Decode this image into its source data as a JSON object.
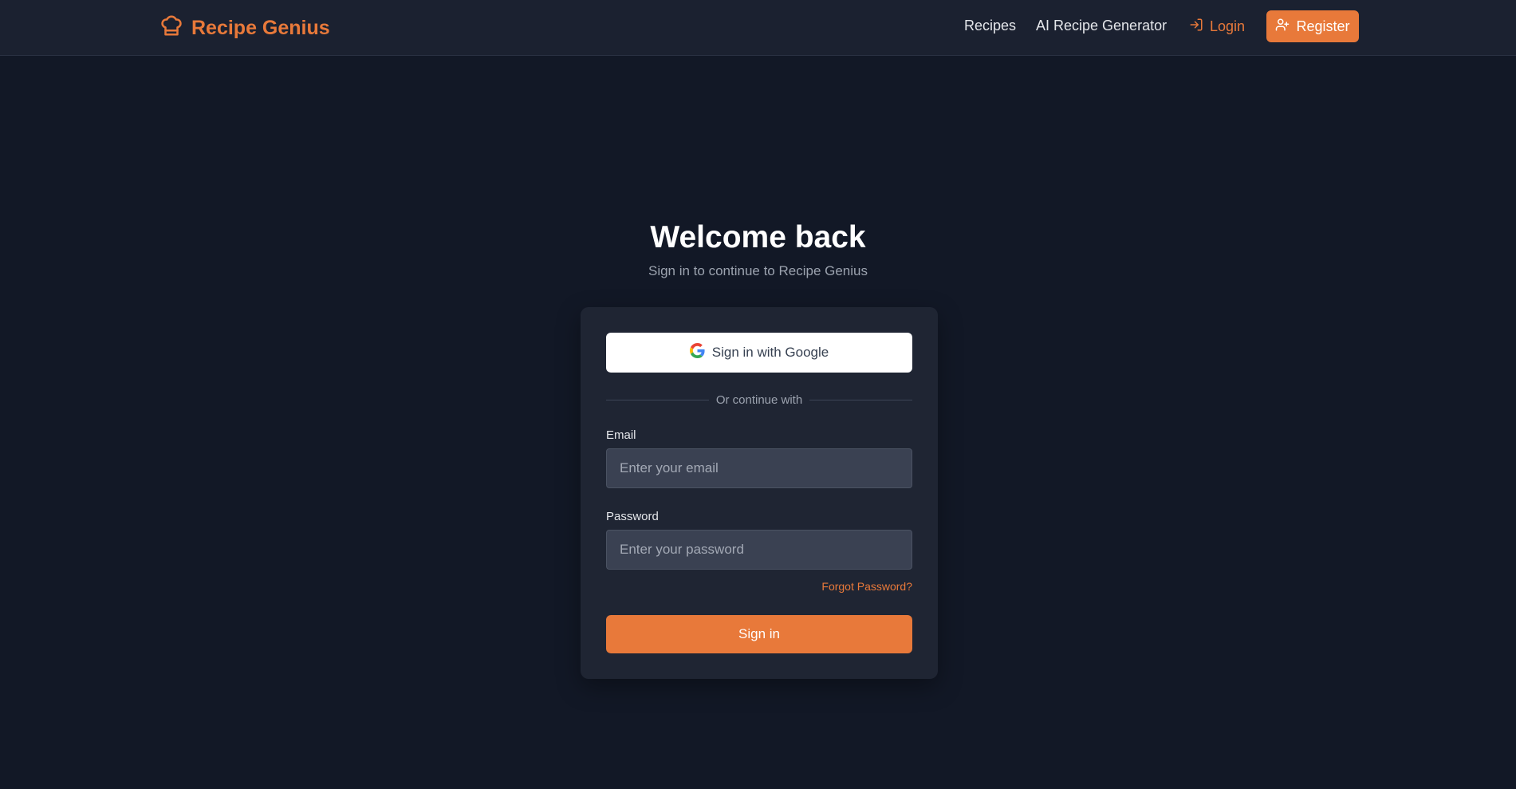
{
  "navbar": {
    "brand": "Recipe Genius",
    "brand_icon": "chef-hat-icon",
    "links": [
      {
        "label": "Recipes"
      },
      {
        "label": "AI Recipe Generator"
      }
    ],
    "login_label": "Login",
    "login_icon": "log-in-icon",
    "register_label": "Register",
    "register_icon": "user-plus-icon"
  },
  "main": {
    "title": "Welcome back",
    "subtitle": "Sign in to continue to Recipe Genius"
  },
  "form": {
    "google_label": "Sign in with Google",
    "google_icon": "google-icon",
    "divider_text": "Or continue with",
    "email_label": "Email",
    "email_placeholder": "Enter your email",
    "email_value": "",
    "password_label": "Password",
    "password_placeholder": "Enter your password",
    "password_value": "",
    "forgot_label": "Forgot Password?",
    "submit_label": "Sign in"
  },
  "colors": {
    "accent": "#e8793a",
    "background": "#121826",
    "navbar": "#1b2130",
    "card": "#1f2533",
    "input": "#3a4152"
  }
}
